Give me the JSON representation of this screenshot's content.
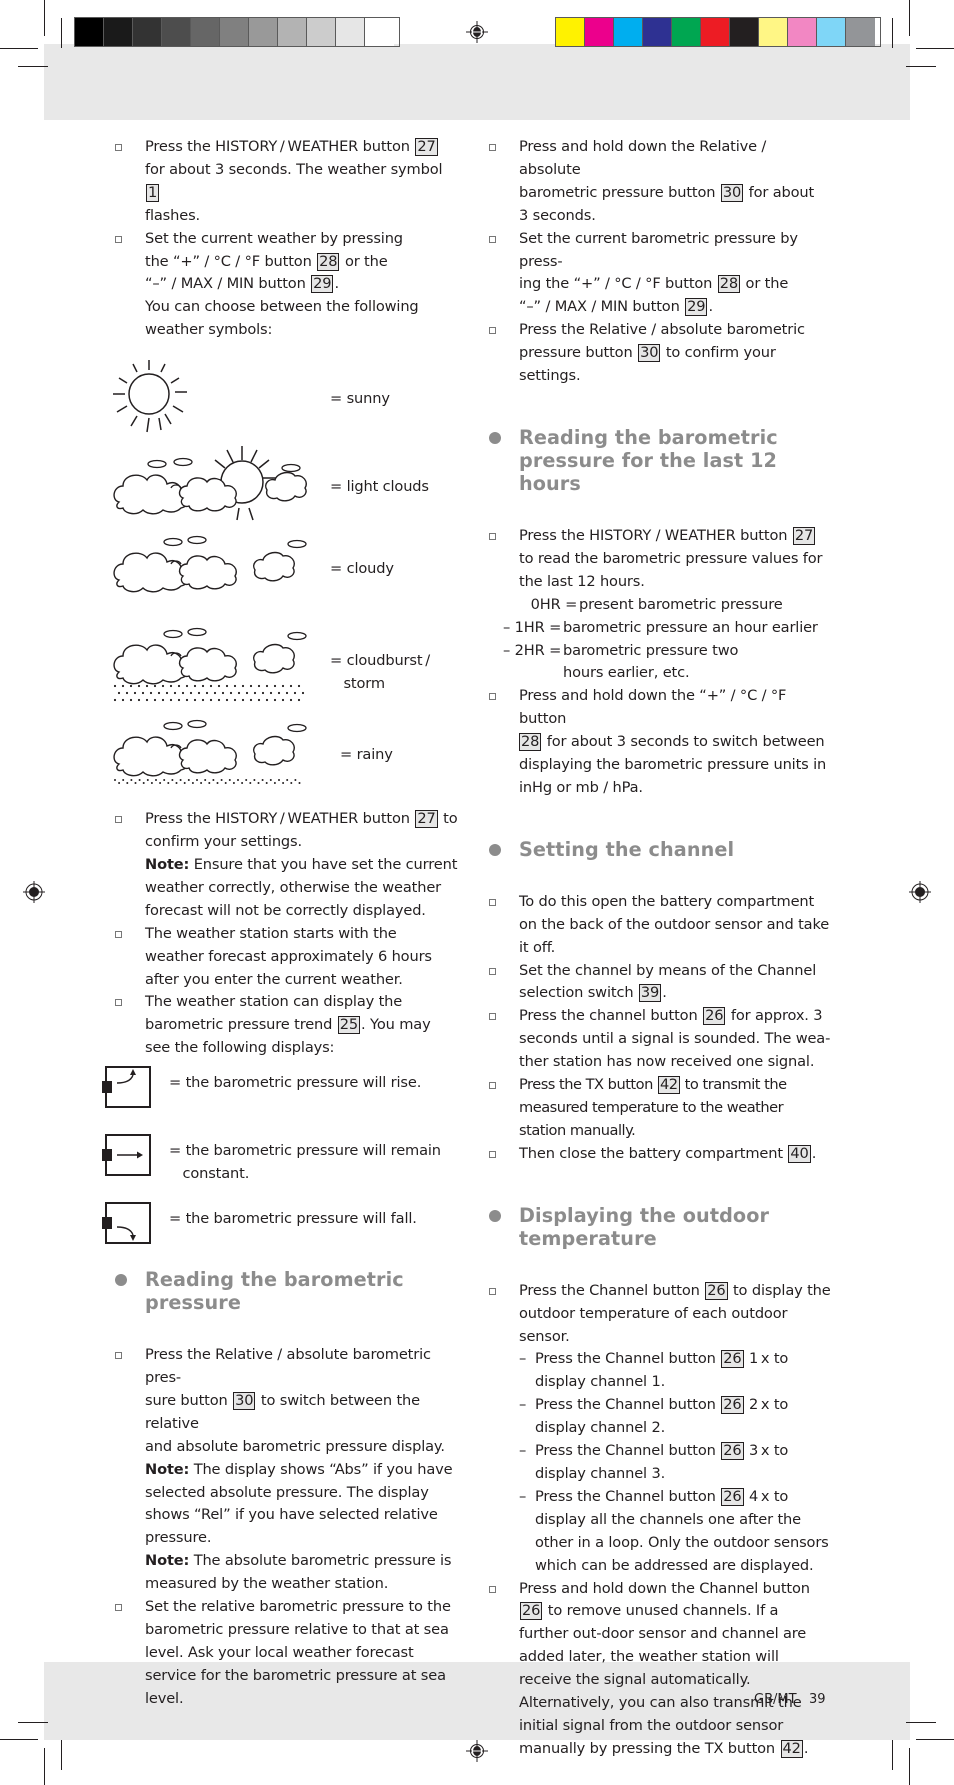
{
  "print_marks": {
    "grayscale_swatches": [
      "#000000",
      "#1a1a1a",
      "#333333",
      "#4d4d4d",
      "#666666",
      "#808080",
      "#999999",
      "#b3b3b3",
      "#cccccc",
      "#e6e6e6",
      "#ffffff"
    ],
    "color_swatches": [
      "#fff200",
      "#ec008c",
      "#00aeef",
      "#2e3192",
      "#00a651",
      "#ed1c24",
      "#231f20",
      "#fff685",
      "#f287c3",
      "#7fd6f7",
      "#939598"
    ]
  },
  "left_column": {
    "intro_items": [
      {
        "parts": [
          "Press the HISTORY / WEATHER button ",
          "27",
          "\nfor about 3 seconds. The weather symbol ",
          "1",
          "\nflashes."
        ]
      },
      {
        "parts": [
          "Set the current weather by pressing\nthe “+” / °C / °F button ",
          "28",
          " or the\n“–” / MAX / MIN button ",
          "29",
          ".\nYou can choose between the following\nweather symbols:"
        ]
      }
    ],
    "weather_symbols": [
      {
        "icon": "sunny-icon",
        "label": "= sunny"
      },
      {
        "icon": "light-clouds-icon",
        "label": "= light clouds"
      },
      {
        "icon": "cloudy-icon",
        "label": "= cloudy"
      },
      {
        "icon": "cloudburst-storm-icon",
        "label": "= cloudburst /\n   storm"
      },
      {
        "icon": "rainy-icon",
        "label": "= rainy"
      }
    ],
    "confirm_item": {
      "text_a": "Press the HISTORY / WEATHER button ",
      "ref": "27",
      "text_b": " to\nconfirm your settings.",
      "note_label": "Note:",
      "note_text": " Ensure that you have set the current weather correctly, otherwise the weather forecast will not be correctly displayed."
    },
    "start_item": "The weather station starts with the weather forecast approximately 6 hours after you enter the current weather.",
    "trend_item": {
      "text_a": "The weather station can display the barometric pressure trend ",
      "ref": "25",
      "text_b": ". You may see the following displays:"
    },
    "trends": [
      {
        "icon": "pressure-rise-icon",
        "label": "= the barometric pressure will rise."
      },
      {
        "icon": "pressure-constant-icon",
        "label": "= the barometric pressure will remain\n   constant."
      },
      {
        "icon": "pressure-fall-icon",
        "label": "= the barometric pressure will fall."
      }
    ],
    "section_reading": {
      "heading": "Reading the barometric pressure",
      "item1": {
        "text_a": "Press the Relative / absolute barometric pres-sure button ",
        "ref": "30",
        "text_b": " to switch between the relative and absolute barometric pressure display.",
        "note1_label": "Note:",
        "note1_text": " The display shows “Abs” if you have selected absolute pressure. The display shows “Rel” if you have selected relative pressure.",
        "note2_label": "Note:",
        "note2_text": " The absolute barometric pressure is measured by the weather station."
      },
      "item2": "Set the relative barometric pressure to the barometric pressure relative to that at sea level. Ask your local weather forecast service for the barometric pressure at sea level."
    }
  },
  "right_column": {
    "items_top": [
      {
        "a": "Press and hold down the Relative / absolute barometric pressure button ",
        "ref": "30",
        "b": " for about 3 seconds."
      },
      {
        "a": "Set the current barometric pressure by press-ing the “+” / °C / °F button ",
        "ref": "28",
        "b": " or the “–” / MAX / MIN button ",
        "ref2": "29",
        "c": "."
      },
      {
        "a": "Press the Relative / absolute barometric pressure button ",
        "ref": "30",
        "b": " to confirm your settings."
      }
    ],
    "section_12h": {
      "heading": "Reading the barometric pressure for the last 12 hours",
      "item1": {
        "a": "Press the HISTORY / WEATHER button ",
        "ref": "27",
        "b": " to read the barometric pressure values for the last 12 hours."
      },
      "hours": [
        {
          "key": "  0HR =",
          "value": "present barometric pressure"
        },
        {
          "key": "– 1HR =",
          "value": "barometric pressure an hour earlier"
        },
        {
          "key": "– 2HR =",
          "value": "barometric pressure two hours earlier, etc."
        }
      ],
      "item2": {
        "a": "Press and hold down the “+” / °C / °F button ",
        "ref": "28",
        "b": " for about 3 seconds to switch between displaying the barometric pressure units in inHg or mb / hPa."
      }
    },
    "section_channel": {
      "heading": "Setting the channel",
      "items": [
        {
          "a": "To do this open the battery compartment on the back of the outdoor sensor and take it off."
        },
        {
          "a": "Set the channel by means of the Channel selection switch ",
          "ref": "39",
          "b": "."
        },
        {
          "a": "Press the channel button ",
          "ref": "26",
          "b": " for approx. 3 seconds until a signal is sounded. The wea-ther station has now received one signal."
        },
        {
          "a": "Press the TX button ",
          "ref": "42",
          "b": " to transmit the measured temperature to the weather station manually."
        },
        {
          "a": "Then close the battery compartment ",
          "ref": "40",
          "b": "."
        }
      ]
    },
    "section_outdoor": {
      "heading": "Displaying the outdoor temperature",
      "item1": {
        "a": "Press the Channel button ",
        "ref": "26",
        "b": " to display the outdoor temperature of each outdoor sensor."
      },
      "subitems": [
        {
          "a": "Press the Channel button ",
          "ref": "26",
          "b": " 1 x to display channel 1."
        },
        {
          "a": "Press the Channel button ",
          "ref": "26",
          "b": " 2 x to display channel 2."
        },
        {
          "a": "Press the Channel button ",
          "ref": "26",
          "b": " 3 x to display channel 3."
        },
        {
          "a": "Press the Channel button ",
          "ref": "26",
          "b": " 4 x to display all the channels one after the other in a loop. Only the outdoor sensors which can be addressed are displayed."
        }
      ],
      "item2": {
        "a": "Press and hold down the Channel button ",
        "ref": "26",
        "b": " to remove unused channels. If a further out-door sensor and channel are added later, the weather station will receive the signal automatically. Alternatively, you can also transmit the initial signal from the outdoor sensor manually by pressing the TX button ",
        "ref2": "42",
        "c": "."
      }
    }
  },
  "footer": {
    "locale": "GB/MT",
    "page_number": "39"
  }
}
